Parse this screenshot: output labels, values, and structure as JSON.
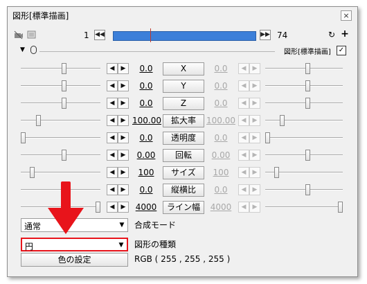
{
  "window": {
    "title": "図形[標準描画]",
    "close_label": "×"
  },
  "timeline": {
    "start": "1",
    "end": "74",
    "bar_color": "#3c7fd9"
  },
  "object": {
    "label": "図形[標準描画]",
    "checked": "✓"
  },
  "params": [
    {
      "name": "X",
      "left_value": "0.0",
      "right_value": "0.0",
      "left_thumb_pct": 0.55,
      "right_thumb_pct": 0.55
    },
    {
      "name": "Y",
      "left_value": "0.0",
      "right_value": "0.0",
      "left_thumb_pct": 0.55,
      "right_thumb_pct": 0.55
    },
    {
      "name": "Z",
      "left_value": "0.0",
      "right_value": "0.0",
      "left_thumb_pct": 0.55,
      "right_thumb_pct": 0.55
    },
    {
      "name": "拡大率",
      "left_value": "100.00",
      "right_value": "100.00",
      "left_thumb_pct": 0.2,
      "right_thumb_pct": 0.2
    },
    {
      "name": "透明度",
      "left_value": "0.0",
      "right_value": "0.0",
      "left_thumb_pct": 0.0,
      "right_thumb_pct": 0.0
    },
    {
      "name": "回転",
      "left_value": "0.00",
      "right_value": "0.00",
      "left_thumb_pct": 0.55,
      "right_thumb_pct": 0.55
    },
    {
      "name": "サイズ",
      "left_value": "100",
      "right_value": "100",
      "left_thumb_pct": 0.12,
      "right_thumb_pct": 0.12
    },
    {
      "name": "縦横比",
      "left_value": "0.0",
      "right_value": "0.0",
      "left_thumb_pct": 0.55,
      "right_thumb_pct": 0.55
    },
    {
      "name": "ライン幅",
      "left_value": "4000",
      "right_value": "4000",
      "left_thumb_pct": 1.0,
      "right_thumb_pct": 1.0
    }
  ],
  "blend": {
    "value": "通常",
    "label": "合成モード"
  },
  "shape": {
    "value": "円",
    "label": "図形の種類"
  },
  "color": {
    "button_label": "色の設定",
    "text": "RGB ( 255 , 255 , 255 )"
  },
  "annotation": {
    "color": "#e8141b"
  }
}
